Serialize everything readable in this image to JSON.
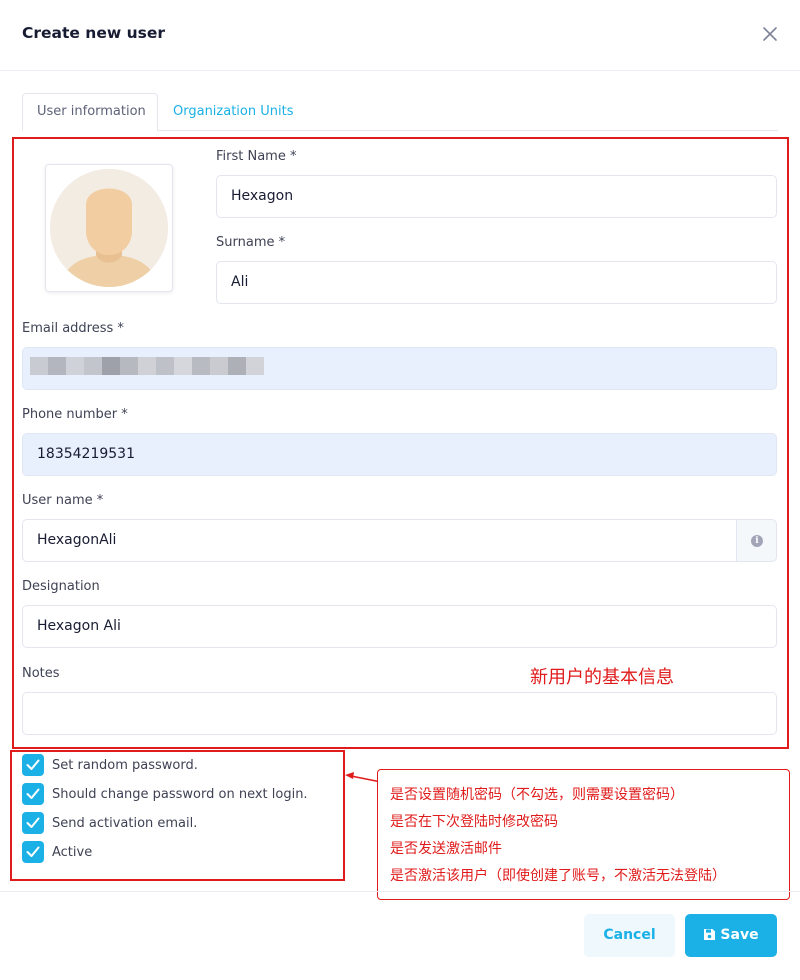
{
  "modal": {
    "title": "Create new user"
  },
  "tabs": [
    {
      "label": "User information",
      "active": true
    },
    {
      "label": "Organization Units",
      "active": false
    }
  ],
  "form": {
    "first_name": {
      "label": "First Name *",
      "value": "Hexagon"
    },
    "surname": {
      "label": "Surname *",
      "value": "Ali"
    },
    "email": {
      "label": "Email address *",
      "value": ""
    },
    "phone": {
      "label": "Phone number *",
      "value": "18354219531"
    },
    "username": {
      "label": "User name *",
      "value": "HexagonAli"
    },
    "designation": {
      "label": "Designation",
      "value": "Hexagon Ali"
    },
    "notes": {
      "label": "Notes",
      "value": ""
    }
  },
  "checkboxes": [
    {
      "label": "Set random password.",
      "checked": true
    },
    {
      "label": "Should change password on next login.",
      "checked": true
    },
    {
      "label": "Send activation email.",
      "checked": true
    },
    {
      "label": "Active",
      "checked": true
    }
  ],
  "annotations": {
    "section_title": "新用户的基本信息",
    "callout_lines": [
      "是否设置随机密码（不勾选，则需要设置密码）",
      "是否在下次登陆时修改密码",
      "是否发送激活邮件",
      "是否激活该用户（即使创建了账号，不激活无法登陆）"
    ]
  },
  "footer": {
    "cancel_label": "Cancel",
    "save_label": "Save"
  },
  "colors": {
    "accent": "#1bb1e6",
    "annotation": "#e01b1b",
    "filled_input": "#e8f0fe"
  },
  "icons": [
    "close-icon",
    "info-icon",
    "check-icon",
    "save-icon",
    "avatar-placeholder"
  ]
}
